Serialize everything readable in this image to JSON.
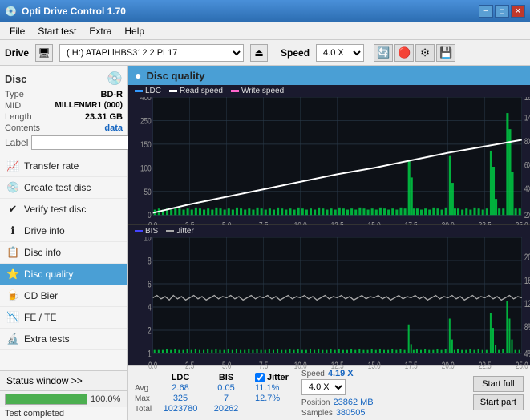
{
  "titlebar": {
    "title": "Opti Drive Control 1.70",
    "minimize": "−",
    "maximize": "□",
    "close": "✕"
  },
  "menubar": {
    "items": [
      "File",
      "Start test",
      "Extra",
      "Help"
    ]
  },
  "drivebar": {
    "drive_label": "Drive",
    "drive_value": "(H:) ATAPI iHBS312  2 PL17",
    "speed_label": "Speed",
    "speed_value": "4.0 X"
  },
  "disc": {
    "header": "Disc",
    "type_label": "Type",
    "type_value": "BD-R",
    "mid_label": "MID",
    "mid_value": "MILLENMR1 (000)",
    "length_label": "Length",
    "length_value": "23.31 GB",
    "contents_label": "Contents",
    "contents_value": "data",
    "label_label": "Label",
    "label_placeholder": ""
  },
  "nav": {
    "items": [
      {
        "id": "transfer-rate",
        "label": "Transfer rate",
        "icon": "📈"
      },
      {
        "id": "create-test-disc",
        "label": "Create test disc",
        "icon": "💿"
      },
      {
        "id": "verify-test-disc",
        "label": "Verify test disc",
        "icon": "✔"
      },
      {
        "id": "drive-info",
        "label": "Drive info",
        "icon": "ℹ"
      },
      {
        "id": "disc-info",
        "label": "Disc info",
        "icon": "📋"
      },
      {
        "id": "disc-quality",
        "label": "Disc quality",
        "icon": "⭐",
        "active": true
      },
      {
        "id": "cd-bier",
        "label": "CD Bier",
        "icon": "🍺"
      },
      {
        "id": "fe-te",
        "label": "FE / TE",
        "icon": "📉"
      },
      {
        "id": "extra-tests",
        "label": "Extra tests",
        "icon": "🔬"
      }
    ]
  },
  "status_window": "Status window >>",
  "progress": {
    "percent": 100,
    "value": "100.0%"
  },
  "status_text": "Test completed",
  "chart": {
    "title": "Disc quality",
    "icon": "●",
    "legend_top": [
      {
        "label": "LDC",
        "color": "#3399ff"
      },
      {
        "label": "Read speed",
        "color": "#ffffff"
      },
      {
        "label": "Write speed",
        "color": "#ff66cc"
      }
    ],
    "legend_bottom": [
      {
        "label": "BIS",
        "color": "#4444ff"
      },
      {
        "label": "Jitter",
        "color": "#ffffff"
      }
    ],
    "top_ymax": 400,
    "top_y2max": 18,
    "bottom_ymax": 10,
    "bottom_y2max": 20,
    "xmax": 25,
    "x_labels": [
      "0.0",
      "2.5",
      "5.0",
      "7.5",
      "10.0",
      "12.5",
      "15.0",
      "17.5",
      "20.0",
      "22.5",
      "25.0"
    ],
    "bottom_x_labels": [
      "0.0",
      "2.5",
      "5.0",
      "7.5",
      "10.0",
      "12.5",
      "15.0",
      "17.5",
      "20.0",
      "22.5",
      "25.0"
    ]
  },
  "stats": {
    "ldc_label": "LDC",
    "bis_label": "BIS",
    "jitter_label": "Jitter",
    "jitter_checked": true,
    "speed_label": "Speed",
    "position_label": "Position",
    "samples_label": "Samples",
    "avg_label": "Avg",
    "max_label": "Max",
    "total_label": "Total",
    "ldc_avg": "2.68",
    "ldc_max": "325",
    "ldc_total": "1023780",
    "bis_avg": "0.05",
    "bis_max": "7",
    "bis_total": "20262",
    "jitter_avg": "11.1%",
    "jitter_max": "12.7%",
    "jitter_total": "",
    "speed_val": "4.19 X",
    "speed_select": "4.0 X",
    "position_val": "23862 MB",
    "samples_val": "380505",
    "start_full_label": "Start full",
    "start_part_label": "Start part"
  }
}
